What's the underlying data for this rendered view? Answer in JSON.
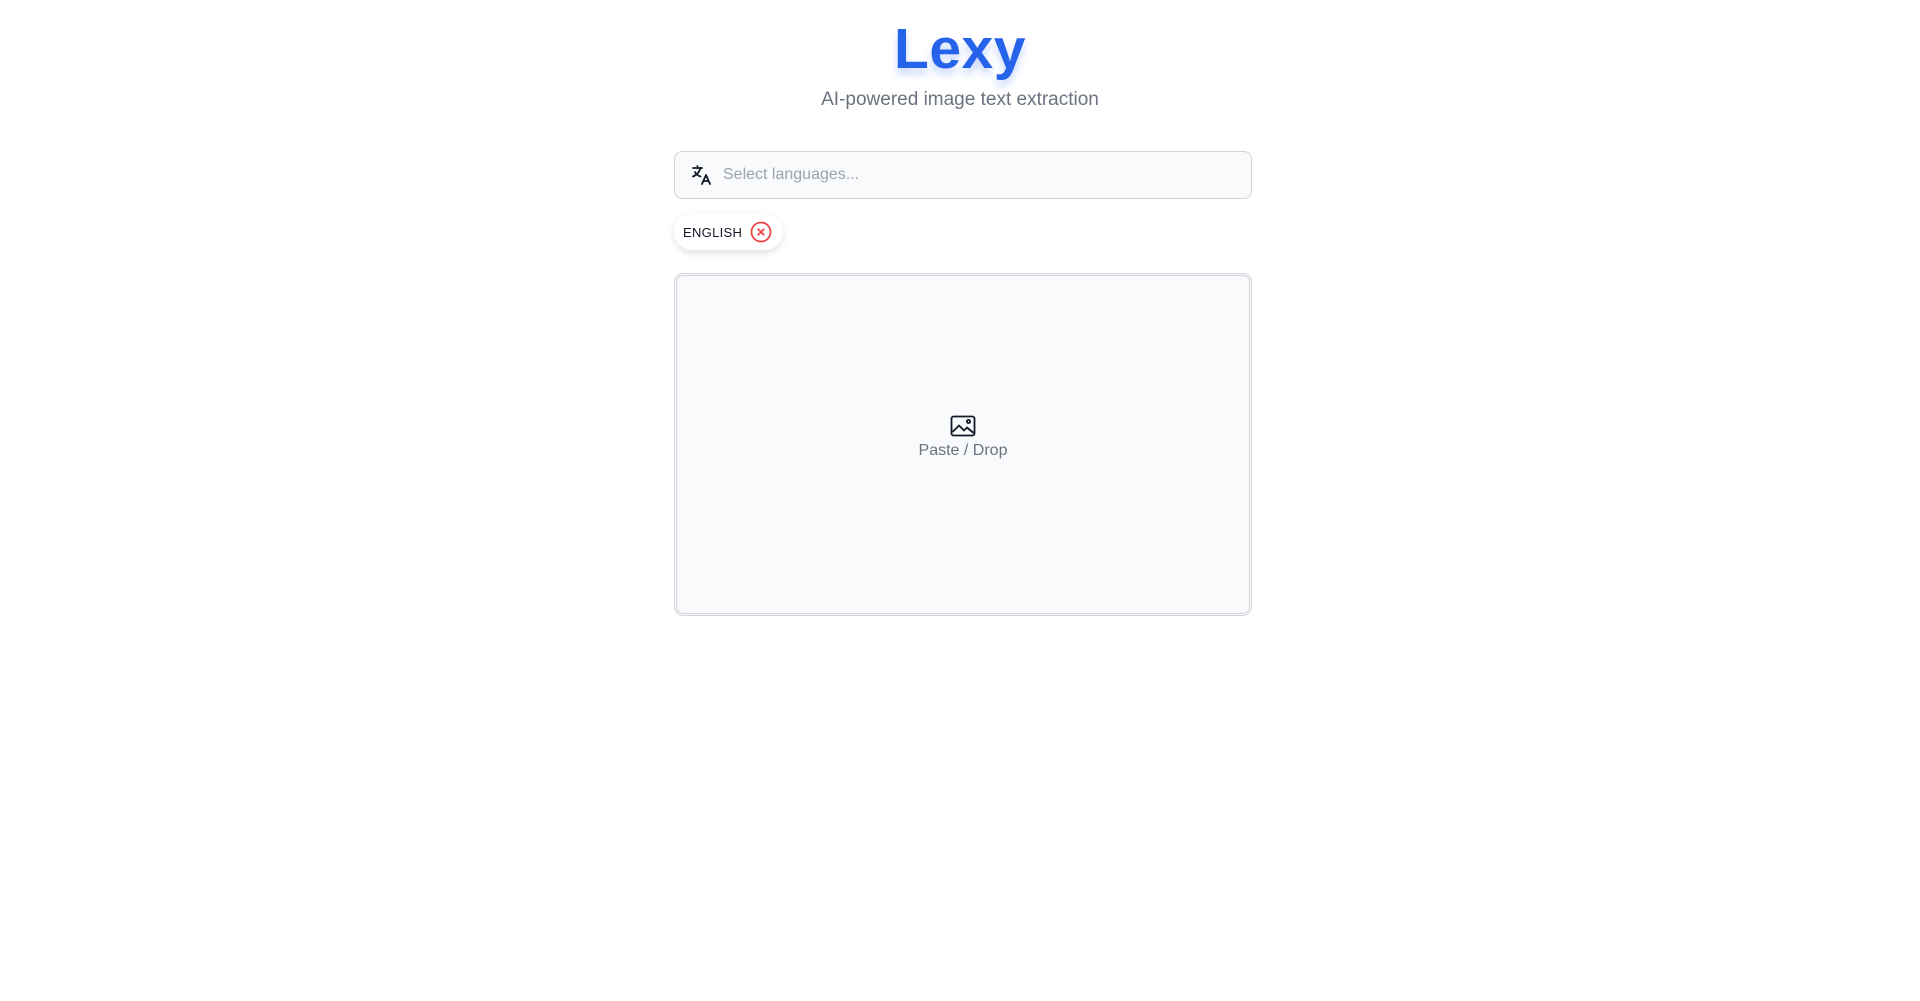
{
  "header": {
    "title": "Lexy",
    "subtitle": "AI-powered image text extraction"
  },
  "language_select": {
    "placeholder": "Select languages...",
    "icon": "translate-icon"
  },
  "selected_languages": [
    {
      "label": "ENGLISH",
      "remove_icon": "close-circle-icon"
    }
  ],
  "dropzone": {
    "label": "Paste / Drop",
    "icon": "image-icon"
  },
  "colors": {
    "accent": "#2563eb",
    "remove": "#ef4444",
    "muted_text": "#6b7280",
    "border": "#d1d5db",
    "surface": "#f9fafb"
  }
}
